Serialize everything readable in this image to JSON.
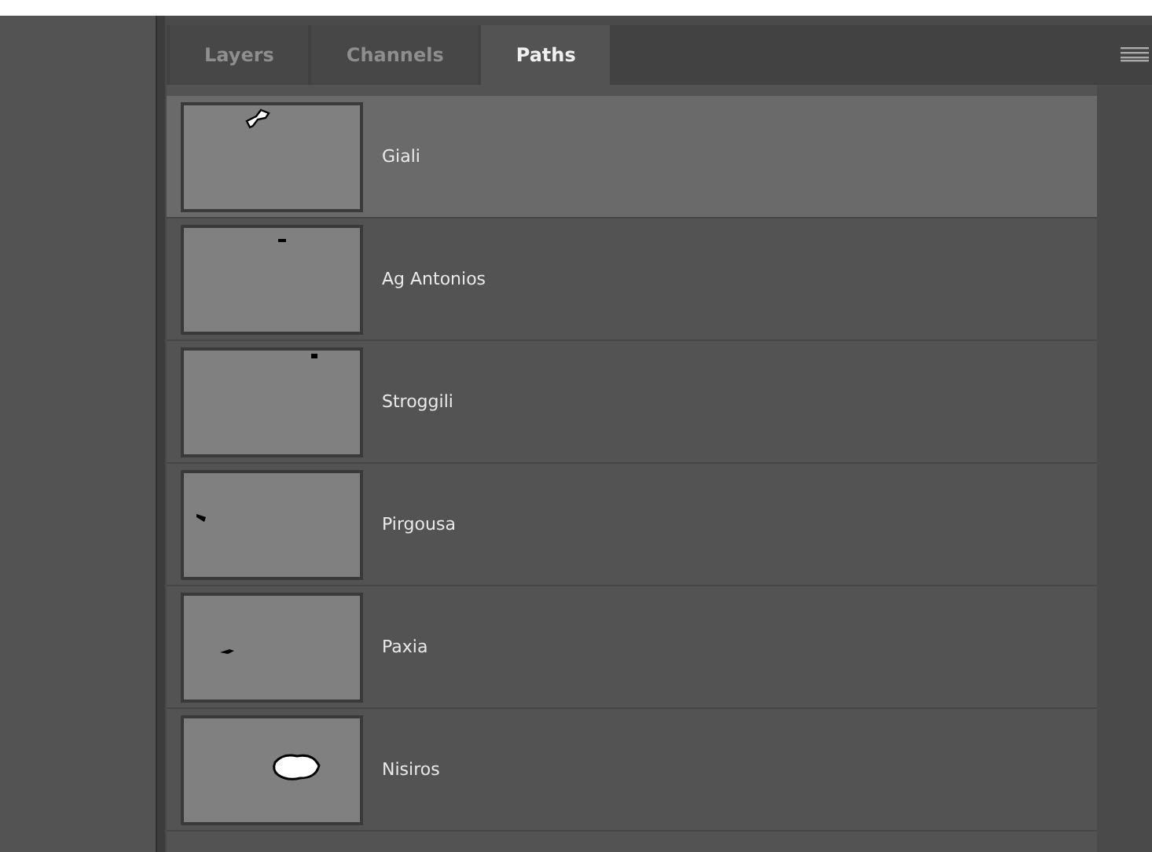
{
  "tabs": [
    {
      "label": "Layers",
      "selected": false
    },
    {
      "label": "Channels",
      "selected": false
    },
    {
      "label": "Paths",
      "selected": true
    }
  ],
  "paths": [
    {
      "name": "Giali",
      "selected": true
    },
    {
      "name": "Ag Antonios",
      "selected": false
    },
    {
      "name": "Stroggili",
      "selected": false
    },
    {
      "name": "Pirgousa",
      "selected": false
    },
    {
      "name": "Paxia",
      "selected": false
    },
    {
      "name": "Nisiros",
      "selected": false
    }
  ]
}
